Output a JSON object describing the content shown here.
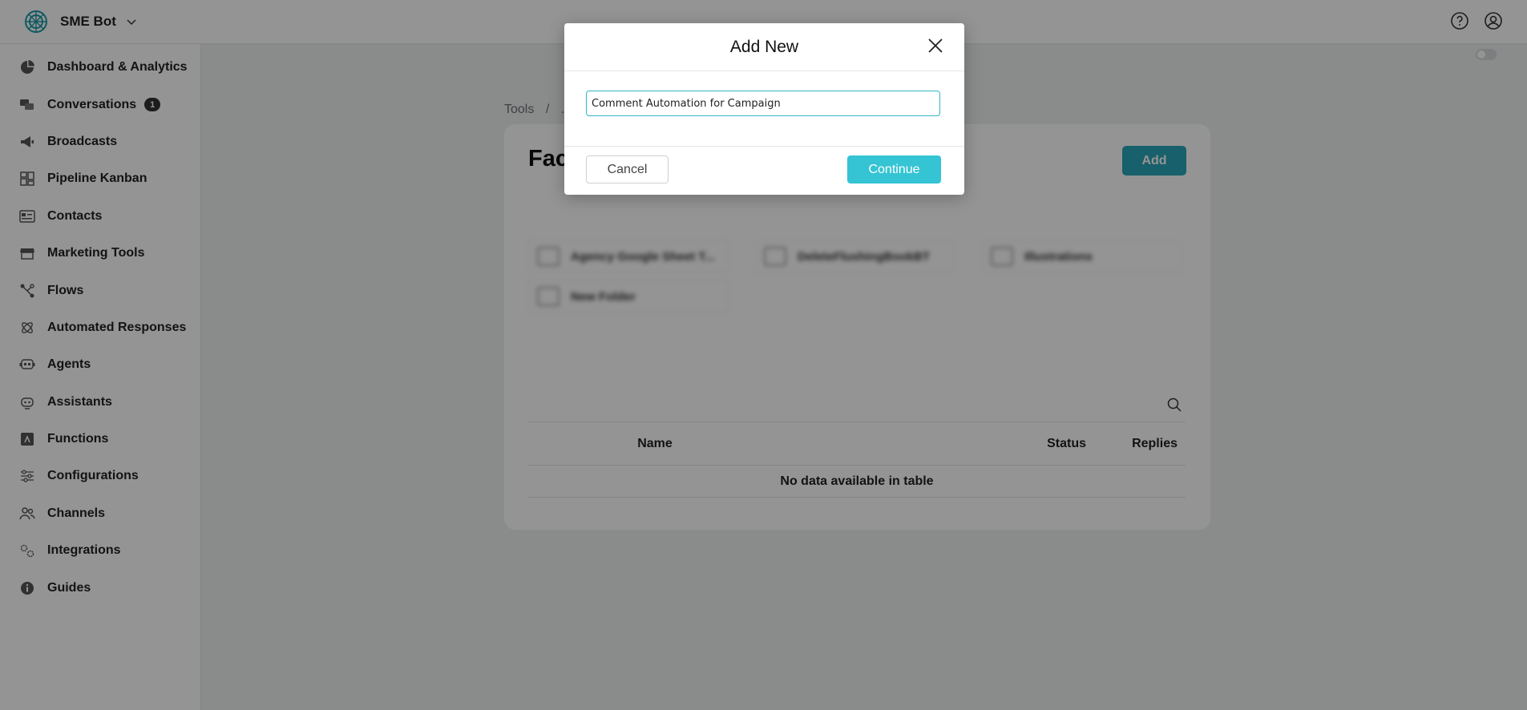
{
  "brand": {
    "name": "SME Bot",
    "logo_icon": "openai-style-logo-icon",
    "accent": "#2aa6b8"
  },
  "topbar": {
    "help_icon": "help-circle-icon",
    "account_icon": "user-circle-icon"
  },
  "sidebar": {
    "items": [
      {
        "label": "Dashboard & Analytics",
        "icon": "pie-chart-icon"
      },
      {
        "label": "Conversations",
        "icon": "chat-bubbles-icon",
        "badge": "1"
      },
      {
        "label": "Broadcasts",
        "icon": "megaphone-icon"
      },
      {
        "label": "Pipeline Kanban",
        "icon": "kanban-icon"
      },
      {
        "label": "Contacts",
        "icon": "contact-card-icon"
      },
      {
        "label": "Marketing Tools",
        "icon": "storefront-icon"
      },
      {
        "label": "Flows",
        "icon": "flow-icon"
      },
      {
        "label": "Automated Responses",
        "icon": "atom-icon"
      },
      {
        "label": "Agents",
        "icon": "agent-icon"
      },
      {
        "label": "Assistants",
        "icon": "robot-icon"
      },
      {
        "label": "Functions",
        "icon": "function-icon"
      },
      {
        "label": "Configurations",
        "icon": "sliders-icon"
      },
      {
        "label": "Channels",
        "icon": "users-icon"
      },
      {
        "label": "Integrations",
        "icon": "gears-icon"
      },
      {
        "label": "Guides",
        "icon": "info-icon"
      }
    ]
  },
  "main": {
    "breadcrumb": [
      "Tools",
      "/",
      "..."
    ],
    "card_title": "Fac",
    "add_label": "Add",
    "folders": [
      {
        "label": "Agency Google Sheet T..."
      },
      {
        "label": "DeleteFlushingBookBT"
      },
      {
        "label": "Illustrations"
      },
      {
        "label": "New Folder"
      }
    ],
    "table": {
      "columns": [
        "Name",
        "Status",
        "Replies"
      ],
      "empty_text": "No data available in table"
    }
  },
  "modal": {
    "title": "Add New",
    "input_value": "Comment Automation for Campaign",
    "cancel_label": "Cancel",
    "continue_label": "Continue"
  }
}
